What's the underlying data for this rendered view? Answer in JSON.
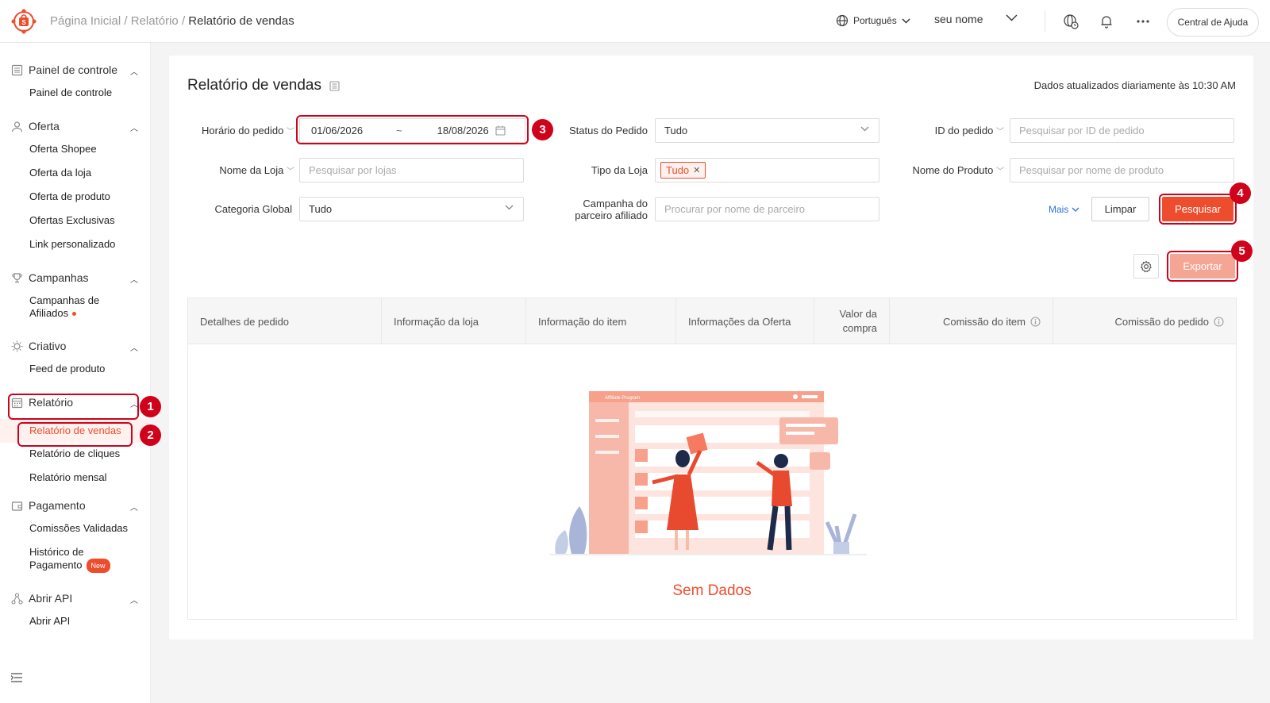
{
  "topbar": {
    "breadcrumb": [
      "Página Inicial",
      "Relatório"
    ],
    "breadcrumb_sep": "/",
    "breadcrumb_current": "Relatório de vendas",
    "language": "Português",
    "username": "seu nome",
    "help": "Central de Ajuda",
    "icons": [
      "globe-clock-icon",
      "bell-icon",
      "more-icon"
    ]
  },
  "sidebar": {
    "sections": [
      {
        "title": "Painel de controle",
        "icon": "dashboard-icon",
        "items": [
          "Painel de controle"
        ]
      },
      {
        "title": "Oferta",
        "icon": "user-icon",
        "items": [
          "Oferta Shopee",
          "Oferta da loja",
          "Oferta de produto",
          "Ofertas Exclusivas",
          "Link personalizado"
        ]
      },
      {
        "title": "Campanhas",
        "icon": "trophy-icon",
        "items": [
          "Campanhas de Afiliados"
        ]
      },
      {
        "title": "Criativo",
        "icon": "bulb-icon",
        "items": [
          "Feed de produto"
        ]
      },
      {
        "title": "Relatório",
        "icon": "calendar-icon",
        "items": [
          "Relatório de vendas",
          "Relatório de cliques",
          "Relatório mensal"
        ]
      },
      {
        "title": "Pagamento",
        "icon": "wallet-icon",
        "items": [
          "Comissões Validadas",
          "Histórico de Pagamento"
        ]
      },
      {
        "title": "Abrir API",
        "icon": "api-icon",
        "items": [
          "Abrir API"
        ]
      }
    ],
    "new_badge": "New",
    "active_item": "Relatório de vendas"
  },
  "page": {
    "title": "Relatório de vendas",
    "updated": "Dados atualizados diariamente às 10:30 AM"
  },
  "filters": {
    "order_time": {
      "label": "Horário do pedido",
      "start": "01/06/2026",
      "sep": "~",
      "end": "18/08/2026"
    },
    "order_status": {
      "label": "Status do Pedido",
      "value": "Tudo"
    },
    "order_id": {
      "label": "ID do pedido",
      "placeholder": "Pesquisar por ID de pedido"
    },
    "store_name": {
      "label": "Nome da Loja",
      "placeholder": "Pesquisar por lojas"
    },
    "store_type": {
      "label": "Tipo da Loja",
      "tag": "Tudo"
    },
    "product_name": {
      "label": "Nome do Produto",
      "placeholder": "Pesquisar por nome de produto"
    },
    "global_category": {
      "label": "Categoria Global",
      "value": "Tudo"
    },
    "partner_campaign": {
      "label_line1": "Campanha do",
      "label_line2": "parceiro afiliado",
      "placeholder": "Procurar por nome de parceiro"
    }
  },
  "actions": {
    "more": "Mais",
    "clear": "Limpar",
    "search": "Pesquisar",
    "export": "Exportar"
  },
  "table": {
    "columns": [
      "Detalhes de pedido",
      "Informação da loja",
      "Informação do item",
      "Informações da Oferta",
      "Valor da compra",
      "Comissão do item",
      "Comissão do pedido"
    ],
    "empty": "Sem Dados",
    "illustration_caption": "Affiliate Program"
  },
  "annotations": [
    "1",
    "2",
    "3",
    "4",
    "5"
  ],
  "colors": {
    "accent": "#ee4d2d",
    "highlight": "#d0021b",
    "link": "#2673dd"
  }
}
